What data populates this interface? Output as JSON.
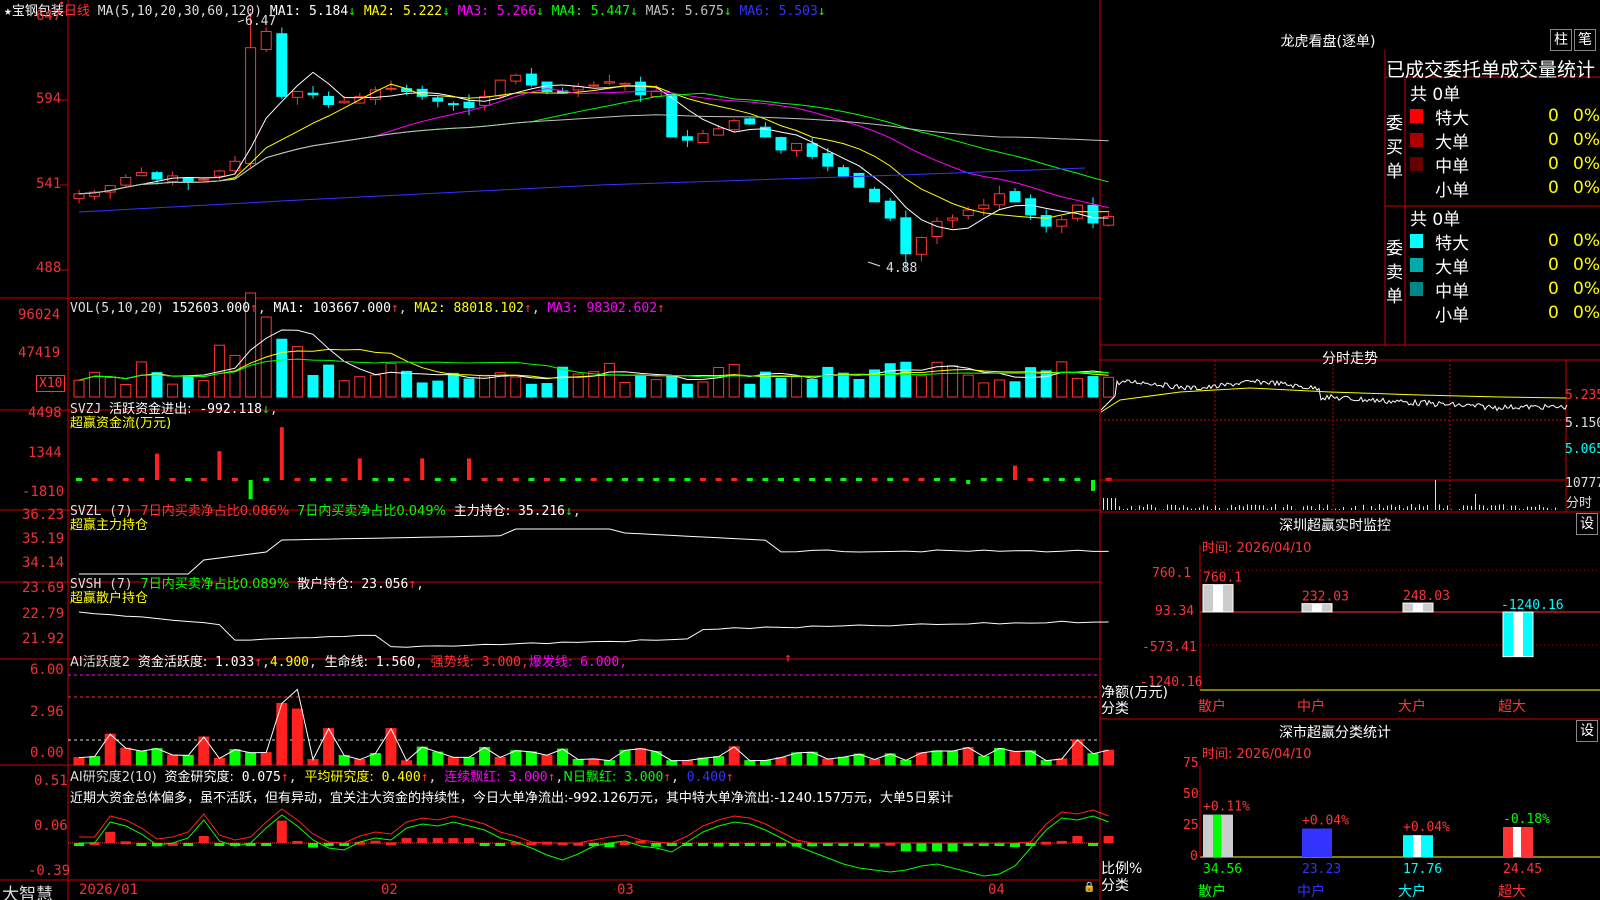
{
  "stock": {
    "star": "★",
    "name": "宝钢包装",
    "period": "日线",
    "ma_header": "MA(5,10,20,30,60,120)",
    "ma": [
      {
        "label": "MA1:",
        "val": "5.184",
        "arr": "↓",
        "color": "#ffffff"
      },
      {
        "label": "MA2:",
        "val": "5.222",
        "arr": "↓",
        "color": "#ffff00"
      },
      {
        "label": "MA3:",
        "val": "5.266",
        "arr": "↓",
        "color": "#ff00ff"
      },
      {
        "label": "MA4:",
        "val": "5.447",
        "arr": "↓",
        "color": "#00ff00"
      },
      {
        "label": "MA5:",
        "val": "5.675",
        "arr": "↓",
        "color": "#c0c0c0"
      },
      {
        "label": "MA6:",
        "val": "5.503",
        "arr": "↓",
        "color": "#3333ff"
      }
    ],
    "high_mark": "6.47",
    "low_mark": "4.88",
    "top_icon": "ᵜ"
  },
  "price_axis": [
    "647",
    "594",
    "541",
    "488"
  ],
  "vol": {
    "header": "VOL(5,10,20)",
    "value": "152603.000",
    "arr": "↑",
    "ma": [
      {
        "label": "MA1:",
        "val": "103667.000",
        "arr": "↑",
        "color": "#ffffff"
      },
      {
        "label": "MA2:",
        "val": "88018.102",
        "arr": "↑",
        "color": "#ffff00"
      },
      {
        "label": "MA3:",
        "val": "98302.602",
        "arr": "↑",
        "color": "#ff00ff"
      }
    ],
    "axis": [
      "96024",
      "47419"
    ],
    "unit": "X10"
  },
  "svzj": {
    "header": "SVZJ",
    "text": "活跃资金进出:",
    "value": "-992.118",
    "arr": "↓",
    "comma": ",",
    "subtitle": "超赢资金流(万元)",
    "axis": [
      "4498",
      "1344",
      "-1810"
    ]
  },
  "svzl": {
    "header": "SVZL (7)",
    "t1": "7日内买卖净占比0.086%",
    "t2": "7日内买卖净占比0.049%",
    "t3": "主力持仓:",
    "value": "35.216",
    "arr": "↓",
    "comma": ",",
    "subtitle": "超赢主力持仓",
    "axis": [
      "36.23",
      "35.19",
      "34.14"
    ]
  },
  "svsh": {
    "header": "SVSH (7)",
    "t1": "7日内买卖净占比0.089%",
    "t3": "散户持仓:",
    "value": "23.056",
    "arr": "↑",
    "comma": ",",
    "subtitle": "超赢散户持仓",
    "axis": [
      "23.69",
      "22.79",
      "21.92"
    ]
  },
  "ai1": {
    "header": "AI活跃度2",
    "t1": "资金活跃度:",
    "v1": "1.033",
    "a1": "↑",
    "v1b": "4.900",
    "t2": "生命线:",
    "v2": "1.560",
    "t3": "强势线:",
    "v3": "3.000",
    "t4": "爆发线:",
    "v4": "6.000",
    "comma": ",",
    "arr": "↑",
    "axis": [
      "6.00",
      "2.96",
      "0.00"
    ]
  },
  "ai2": {
    "header": "AI研究度2(10)",
    "t1": "资金研究度:",
    "v1": "0.075",
    "a1": "↑",
    "t2": "平均研究度:",
    "v2": "0.400",
    "a2": "↑",
    "t3": "连续飘红:",
    "v3": "3.000",
    "a3": "↑",
    "t4": "N日飘红:",
    "v4": "3.000",
    "a4": "↑",
    "v5": "0.400",
    "a5": "↑",
    "comma": ",",
    "commentary": "近期大资金总体偏多，虽不活跃，但有异动，宜关注大资金的持续性，今日大单净流出:-992.126万元，其中特大单净流出:-1240.157万元，大单5日累计",
    "axis": [
      "0.51",
      "0.06",
      "-0.39"
    ]
  },
  "dates": [
    "2026/01",
    "02",
    "03",
    "04"
  ],
  "brand": "大智慧",
  "lock_icon": "🔒",
  "lhb": {
    "title": "龙虎看盘(逐单)",
    "btn1": "柱",
    "btn2": "笔",
    "subtitle": "已成交委托单成交量统计",
    "buy_label": "委买单",
    "sell_label": "委卖单",
    "buy_total": "共 0单",
    "sell_total": "共 0单",
    "buy_rows": [
      {
        "name": "特大",
        "v": "0",
        "p": "0%",
        "c": "#ff0000"
      },
      {
        "name": "大单",
        "v": "0",
        "p": "0%",
        "c": "#aa0000"
      },
      {
        "name": "中单",
        "v": "0",
        "p": "0%",
        "c": "#660000"
      },
      {
        "name": "小单",
        "v": "0",
        "p": "0%",
        "c": "#000000"
      }
    ],
    "sell_rows": [
      {
        "name": "特大",
        "v": "0",
        "p": "0%",
        "c": "#00ffff"
      },
      {
        "name": "大单",
        "v": "0",
        "p": "0%",
        "c": "#00aaaa"
      },
      {
        "name": "中单",
        "v": "0",
        "p": "0%",
        "c": "#008888"
      },
      {
        "name": "小单",
        "v": "0",
        "p": "0%",
        "c": "#000000"
      }
    ]
  },
  "fenshi": {
    "title": "分时走势",
    "axis": [
      "5.235",
      "5.150",
      "5.065"
    ],
    "vol_axis": "10777",
    "vol_label": "分时"
  },
  "sz": {
    "title": "深圳超赢实时监控",
    "btn": "设",
    "time": "时间: 2026/04/10",
    "axis": [
      "760.1",
      "93.34",
      "-573.41",
      "-1240.16"
    ],
    "ylabel": "净额(万元)",
    "xlabel": "分类",
    "cats": [
      "散户",
      "中户",
      "大户",
      "超大"
    ],
    "bar_labels": [
      "760.1",
      "232.03",
      "248.03",
      "-1240.16"
    ]
  },
  "ss": {
    "title": "深市超赢分类统计",
    "btn": "设",
    "time": "时间: 2026/04/10",
    "axis": [
      "75",
      "50",
      "25",
      "0"
    ],
    "ylabel": "比例%",
    "xlabel": "分类",
    "cats": [
      "散户",
      "中户",
      "大户",
      "超大"
    ],
    "changes": [
      "+0.11%",
      "+0.04%",
      "+0.04%",
      "-0.18%"
    ],
    "values": [
      "34.56",
      "23.23",
      "17.76",
      "24.45"
    ]
  },
  "chart_data": [
    {
      "type": "candlestick",
      "title": "宝钢包装 日线",
      "ylim": [
        4.88,
        6.47
      ],
      "x_ticks": [
        "2026/01",
        "02",
        "03",
        "04"
      ],
      "y_ticks": [
        6.47,
        5.94,
        5.41,
        4.88
      ],
      "high": 6.47,
      "low": 4.88
    },
    {
      "type": "bar",
      "title": "深圳超赢实时监控",
      "categories": [
        "散户",
        "中户",
        "大户",
        "超大"
      ],
      "values": [
        760.1,
        232.03,
        248.03,
        -1240.16
      ],
      "ylabel": "净额(万元)",
      "xlabel": "分类",
      "ylim": [
        -1240.16,
        760.1
      ]
    },
    {
      "type": "bar",
      "title": "深市超赢分类统计",
      "categories": [
        "散户",
        "中户",
        "大户",
        "超大"
      ],
      "values": [
        34.56,
        23.23,
        17.76,
        24.45
      ],
      "changes": [
        "+0.11%",
        "+0.04%",
        "+0.04%",
        "-0.18%"
      ],
      "ylabel": "比例%",
      "xlabel": "分类",
      "ylim": [
        0,
        75
      ]
    }
  ]
}
